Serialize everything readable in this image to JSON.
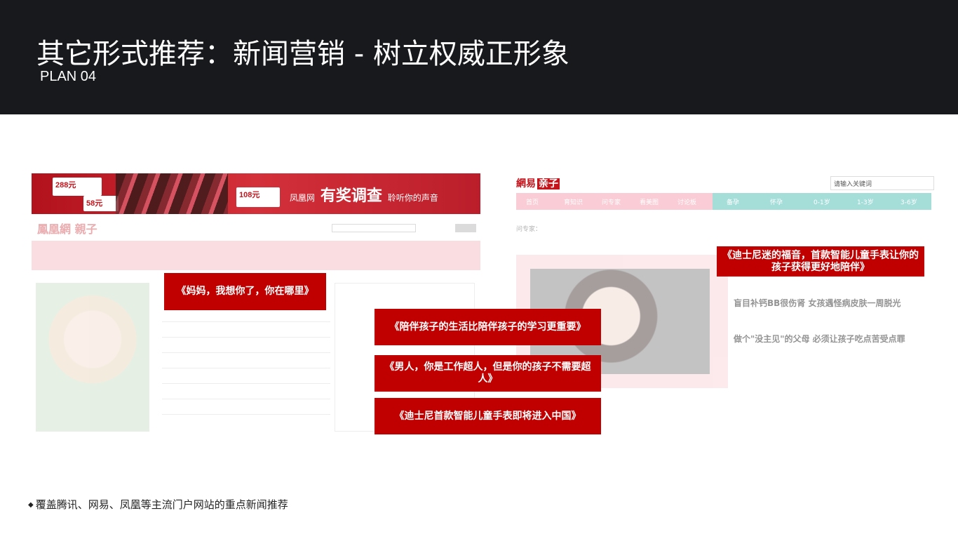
{
  "header": {
    "title": "其它形式推荐：新闻营销 - 树立权威正形象",
    "subtitle": "PLAN 04"
  },
  "left_screenshot": {
    "banner_slogan": "有奖调查",
    "banner_prefix": "凤凰网",
    "banner_suffix": "聆听你的声音",
    "price_1": "288元",
    "price_2": "58元",
    "price_3": "108元",
    "logo": "鳳凰網 親子"
  },
  "right_screenshot": {
    "logo_brand": "網易",
    "logo_section": "亲子",
    "search_placeholder": "请输入关键词",
    "nav_items": [
      "首页",
      "育知识",
      "问专家",
      "看美图",
      "讨论板",
      "备孕",
      "怀孕",
      "0-1岁",
      "1-3岁",
      "3-6岁"
    ],
    "crumb": "问专家：",
    "headlines": [
      "盲目补钙BB很伤肾 女孩遇怪病皮肤一周脱光",
      "做个\"没主见\"的父母 必须让孩子吃点苦受点罪"
    ]
  },
  "callouts": [
    "《妈妈，我想你了，你在哪里》",
    "《陪伴孩子的生活比陪伴孩子的学习更重要》",
    "《男人，你是工作超人，但是你的孩子不需要超人》",
    "《迪士尼首款智能儿童手表即将进入中国》",
    "《迪士尼迷的福音，首款智能儿童手表让你的孩子获得更好地陪伴》"
  ],
  "footnote": {
    "bullet": "◆",
    "text": "覆盖腾讯、网易、凤凰等主流门户网站的重点新闻推荐"
  },
  "colors": {
    "header_bg": "#17191c",
    "callout_bg": "#c00000"
  }
}
